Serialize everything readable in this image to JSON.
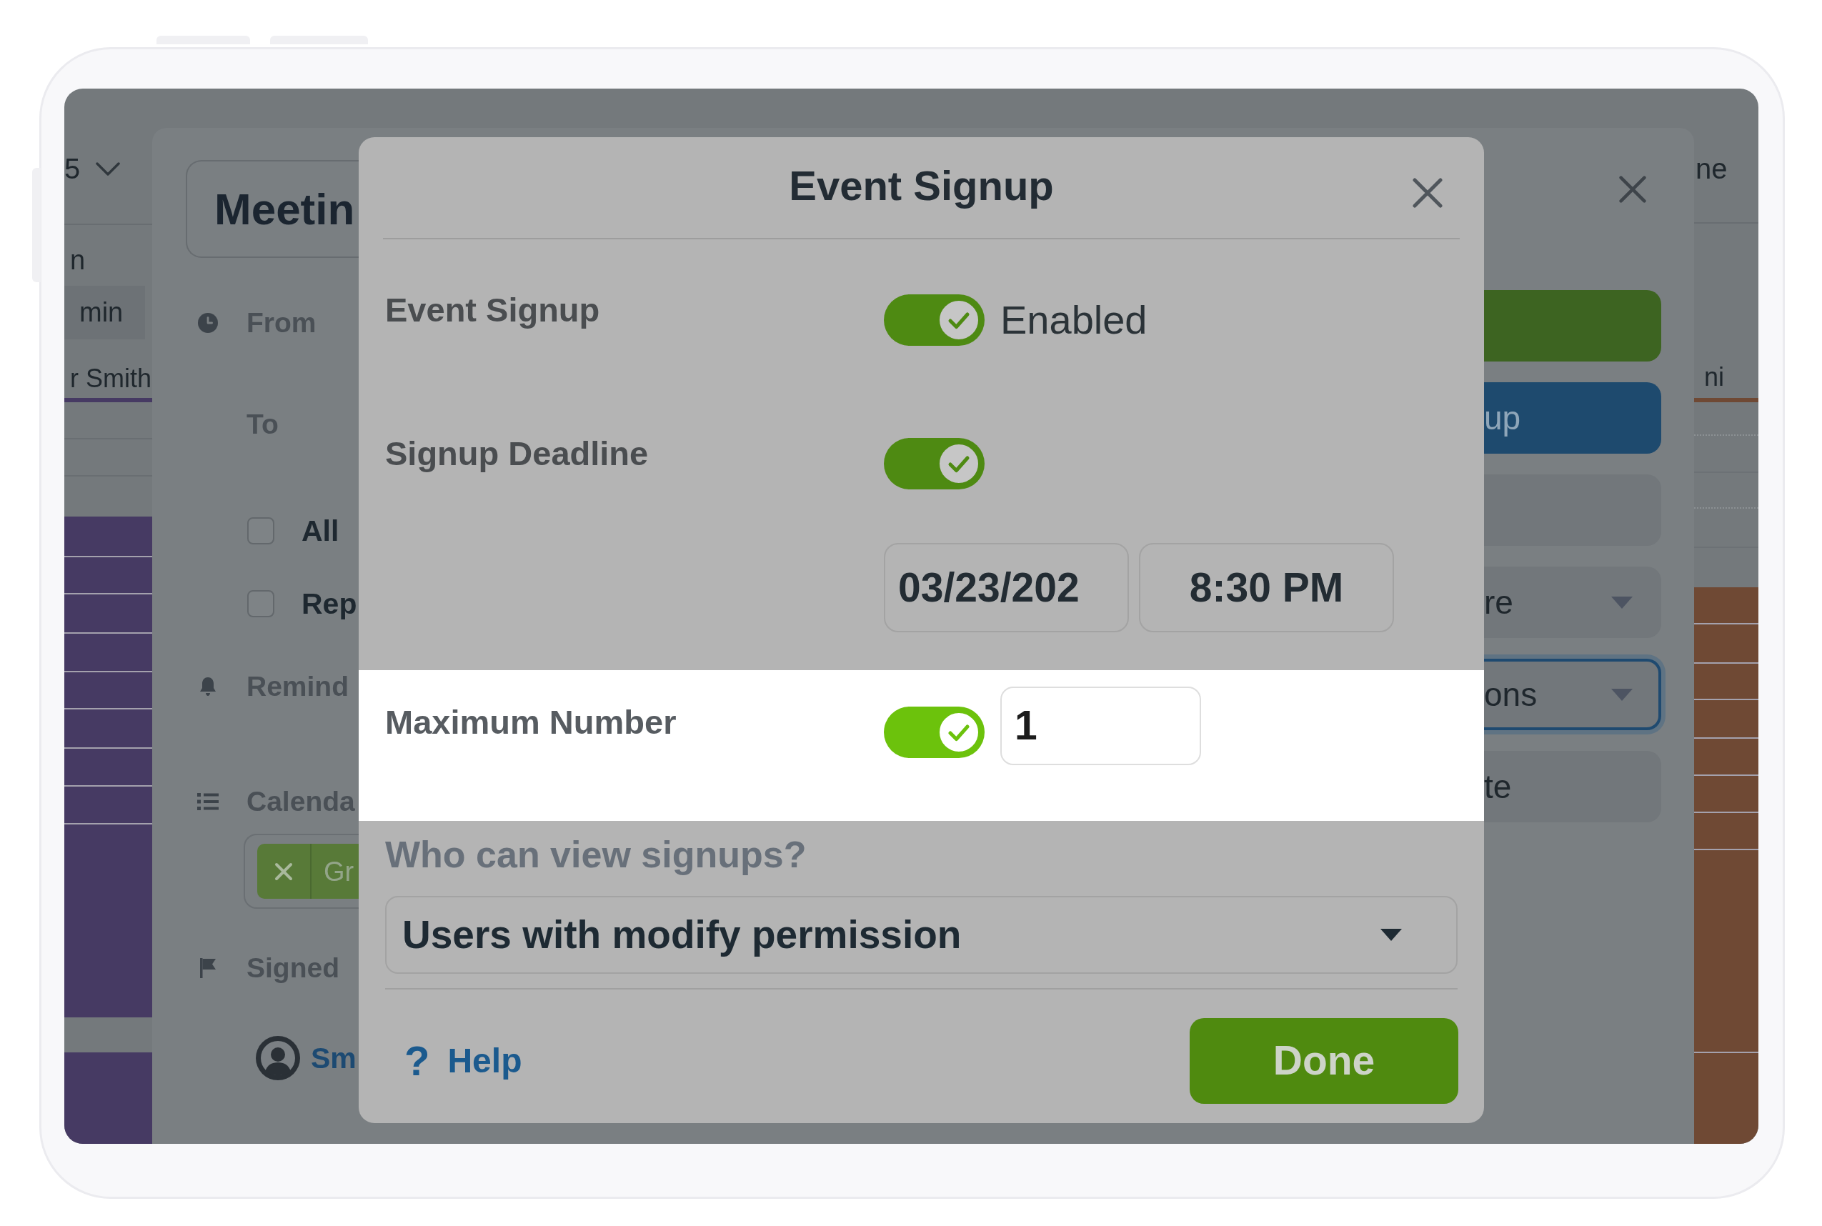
{
  "calendar": {
    "columns": [
      {
        "heading": "5",
        "subheading": "n",
        "duration": "min",
        "person": "r Smith",
        "color": "#463a63"
      },
      {
        "heading": "ne",
        "person": "ni",
        "color": "#6f4934"
      }
    ]
  },
  "event_editor": {
    "title": "Meetin",
    "rows": [
      {
        "kind": "time",
        "label": "From"
      },
      {
        "kind": "plain",
        "label": "To"
      },
      {
        "kind": "checkbox",
        "label": "All",
        "checked": false
      },
      {
        "kind": "checkbox",
        "label": "Rep",
        "checked": false
      },
      {
        "kind": "reminder",
        "label": "Remind"
      },
      {
        "kind": "calendars",
        "label": "Calenda"
      },
      {
        "kind": "tag",
        "label": "Gr"
      },
      {
        "kind": "signed",
        "label": "Signed"
      },
      {
        "kind": "person",
        "label": "Sm"
      }
    ],
    "actions": [
      {
        "kind": "primary"
      },
      {
        "kind": "accent",
        "label": "up"
      },
      {
        "kind": "plain"
      },
      {
        "kind": "dropdown",
        "label": "re",
        "focused": false
      },
      {
        "kind": "dropdown",
        "label": "ons",
        "focused": true
      },
      {
        "kind": "plain",
        "label": "te"
      }
    ]
  },
  "event_signup": {
    "title": "Event Signup",
    "rows": [
      {
        "label": "Event Signup",
        "on": true,
        "highlighted": false,
        "status": "Enabled"
      },
      {
        "label": "Signup Deadline",
        "on": true,
        "highlighted": false,
        "date": "03/23/202",
        "time": "8:30 PM"
      },
      {
        "label": "Maximum Number",
        "on": true,
        "highlighted": true,
        "value": "1"
      }
    ],
    "visibility": {
      "label": "Who can view signups?",
      "value": "Users with modify permission"
    },
    "help": {
      "icon": "?",
      "label": "Help"
    },
    "done": "Done"
  }
}
